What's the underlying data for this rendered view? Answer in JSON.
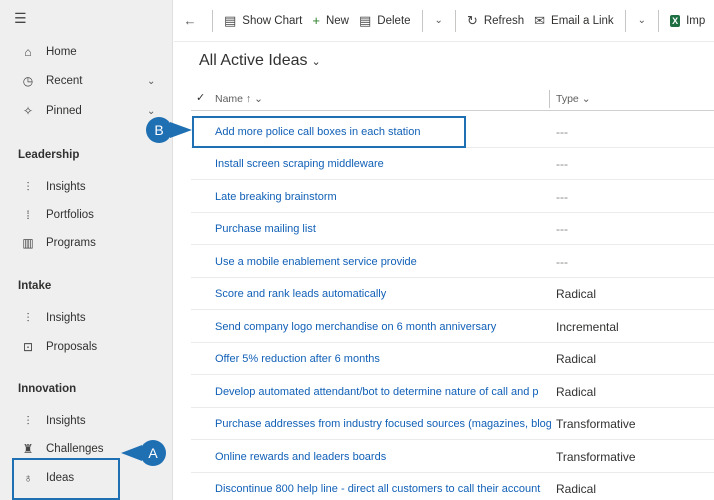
{
  "sidebar": {
    "menu_icon": "☰",
    "top_items": [
      {
        "label": "Home",
        "icon": "home-icon",
        "glyph": "⌂"
      },
      {
        "label": "Recent",
        "icon": "clock-icon",
        "glyph": "◷"
      },
      {
        "label": "Pinned",
        "icon": "pin-icon",
        "glyph": "✧"
      }
    ],
    "groups": [
      {
        "label": "Leadership",
        "items": [
          {
            "label": "Insights",
            "icon": "insights-icon",
            "glyph": "⫶"
          },
          {
            "label": "Portfolios",
            "icon": "portfolio-icon",
            "glyph": "⁞"
          },
          {
            "label": "Programs",
            "icon": "programs-icon",
            "glyph": "▥"
          }
        ]
      },
      {
        "label": "Intake",
        "items": [
          {
            "label": "Insights",
            "icon": "insights-icon",
            "glyph": "⫶"
          },
          {
            "label": "Proposals",
            "icon": "proposals-icon",
            "glyph": "⊡"
          }
        ]
      },
      {
        "label": "Innovation",
        "items": [
          {
            "label": "Insights",
            "icon": "insights-icon",
            "glyph": "⫶"
          },
          {
            "label": "Challenges",
            "icon": "challenges-icon",
            "glyph": "♜"
          },
          {
            "label": "Ideas",
            "icon": "lightbulb-icon",
            "glyph": "♁"
          }
        ]
      }
    ]
  },
  "toolbar": {
    "back_glyph": "←",
    "show_chart": "Show Chart",
    "new": "New",
    "delete": "Delete",
    "refresh": "Refresh",
    "email_link": "Email a Link",
    "import": "Imp"
  },
  "view": {
    "title": "All Active Ideas"
  },
  "grid": {
    "columns": {
      "name": "Name ↑",
      "type": "Type"
    },
    "rows": [
      {
        "name": "Add more police call boxes in each station",
        "type": "---"
      },
      {
        "name": "Install screen scraping middleware",
        "type": "---"
      },
      {
        "name": "Late breaking brainstorm",
        "type": "---"
      },
      {
        "name": "Purchase mailing list",
        "type": "---"
      },
      {
        "name": "Use a mobile enablement service provide",
        "type": "---"
      },
      {
        "name": "Score and rank leads automatically",
        "type": "Radical"
      },
      {
        "name": "Send company logo merchandise on 6 month anniversary",
        "type": "Incremental"
      },
      {
        "name": "Offer 5% reduction after 6 months",
        "type": "Radical"
      },
      {
        "name": "Develop automated attendant/bot to determine nature of call and p",
        "type": "Radical"
      },
      {
        "name": "Purchase addresses from industry focused sources (magazines, blog",
        "type": "Transformative"
      },
      {
        "name": "Online rewards and leaders boards",
        "type": "Transformative"
      },
      {
        "name": "Discontinue 800 help line - direct all customers to call their account",
        "type": "Radical"
      }
    ]
  },
  "callouts": {
    "a": "A",
    "b": "B"
  },
  "colors": {
    "accent": "#1f6fb3",
    "link": "#1160b7"
  }
}
